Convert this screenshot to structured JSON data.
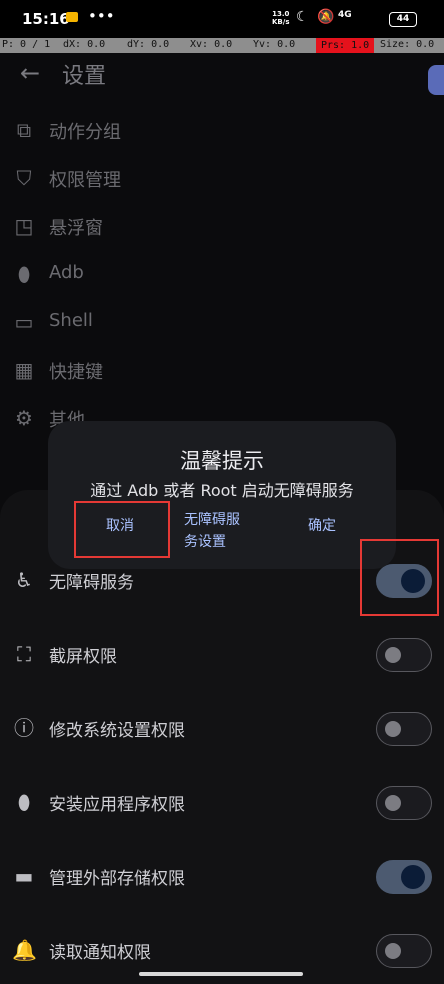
{
  "status_bar": {
    "time": "15:16",
    "dots": "•••",
    "net_speed_top": "13.0",
    "net_speed_bottom": "KB/s",
    "system_icons": "☾ 🔕",
    "network": "4G",
    "battery": "44"
  },
  "pointer_bar": {
    "p": "P: 0 / 1",
    "dx": "dX: 0.0",
    "dy": "dY: 0.0",
    "xv": "Xv: 0.0",
    "yv": "Yv: 0.0",
    "prs": "Prs: 1.0",
    "size": "Size: 0.0"
  },
  "app_bar": {
    "back_icon": "arrow-left-icon",
    "title": "设置"
  },
  "menu": [
    {
      "label": "动作分组",
      "icon": "group-icon"
    },
    {
      "label": "权限管理",
      "icon": "shield-lock-icon"
    },
    {
      "label": "悬浮窗",
      "icon": "floating-window-icon"
    },
    {
      "label": "Adb",
      "icon": "android-icon"
    },
    {
      "label": "Shell",
      "icon": "terminal-icon"
    },
    {
      "label": "快捷键",
      "icon": "shortcut-icon"
    },
    {
      "label": "其他",
      "icon": "gear-icon"
    }
  ],
  "permissions": [
    {
      "label": "无障碍服务",
      "icon": "accessibility-icon",
      "enabled": true
    },
    {
      "label": "截屏权限",
      "icon": "screenshot-icon",
      "enabled": false
    },
    {
      "label": "修改系统设置权限",
      "icon": "info-icon",
      "enabled": false
    },
    {
      "label": "安装应用程序权限",
      "icon": "android-icon",
      "enabled": false
    },
    {
      "label": "管理外部存储权限",
      "icon": "folder-icon",
      "enabled": true
    },
    {
      "label": "读取通知权限",
      "icon": "bell-icon",
      "enabled": false
    }
  ],
  "dialog": {
    "title": "温馨提示",
    "message": "通过 Adb 或者 Root 启动无障碍服务",
    "cancel": "取消",
    "settings_line1": "无障碍服",
    "settings_line2": "务设置",
    "confirm": "确定"
  },
  "colors": {
    "highlight": "#e53935",
    "accent": "#aac2ff",
    "switch_on_track": "#4c5a70",
    "prs_bg": "#e5121c"
  }
}
